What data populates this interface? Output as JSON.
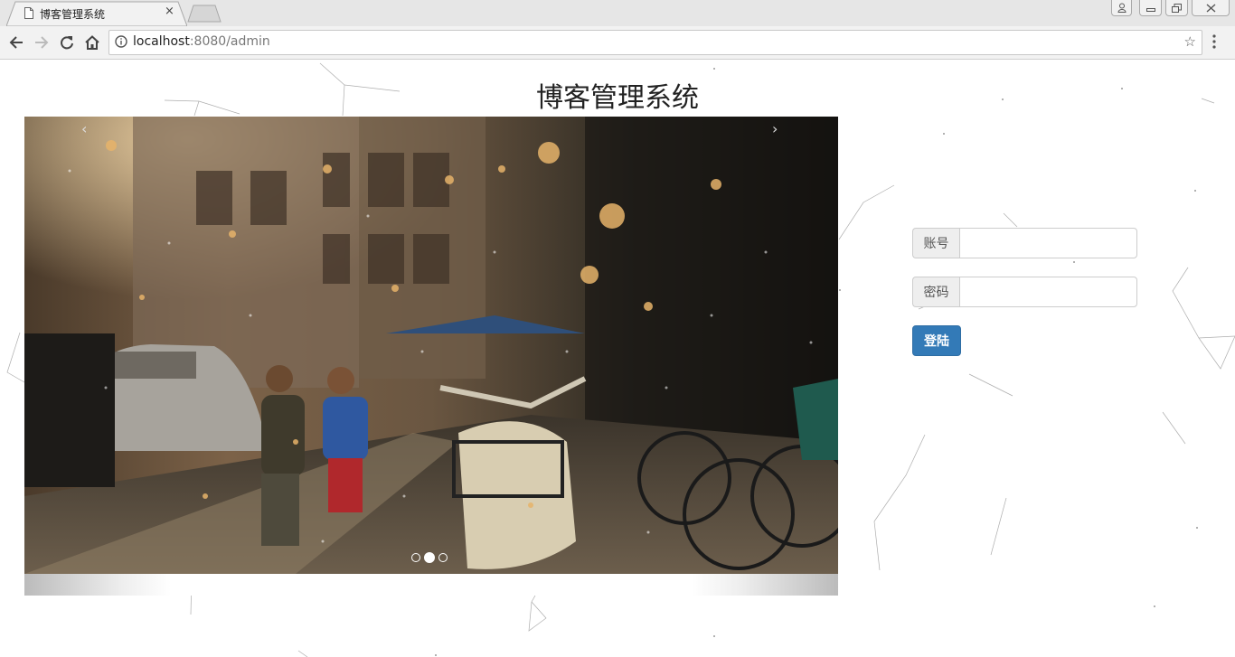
{
  "browser": {
    "tab_title": "博客管理系统",
    "tab_close": "×",
    "url_host": "localhost",
    "url_rest": ":8080/admin",
    "star": "☆"
  },
  "page": {
    "title": "博客管理系统",
    "carousel": {
      "prev": "‹",
      "next": "›",
      "slide_count": 3,
      "active_slide": 2
    },
    "login": {
      "account_label": "账号",
      "account_value": "",
      "password_label": "密码",
      "password_value": "",
      "submit_label": "登陆"
    }
  },
  "colors": {
    "primary_button": "#337ab7",
    "tab_strip": "#e6e6e6",
    "toolbar": "#f2f2f2"
  }
}
